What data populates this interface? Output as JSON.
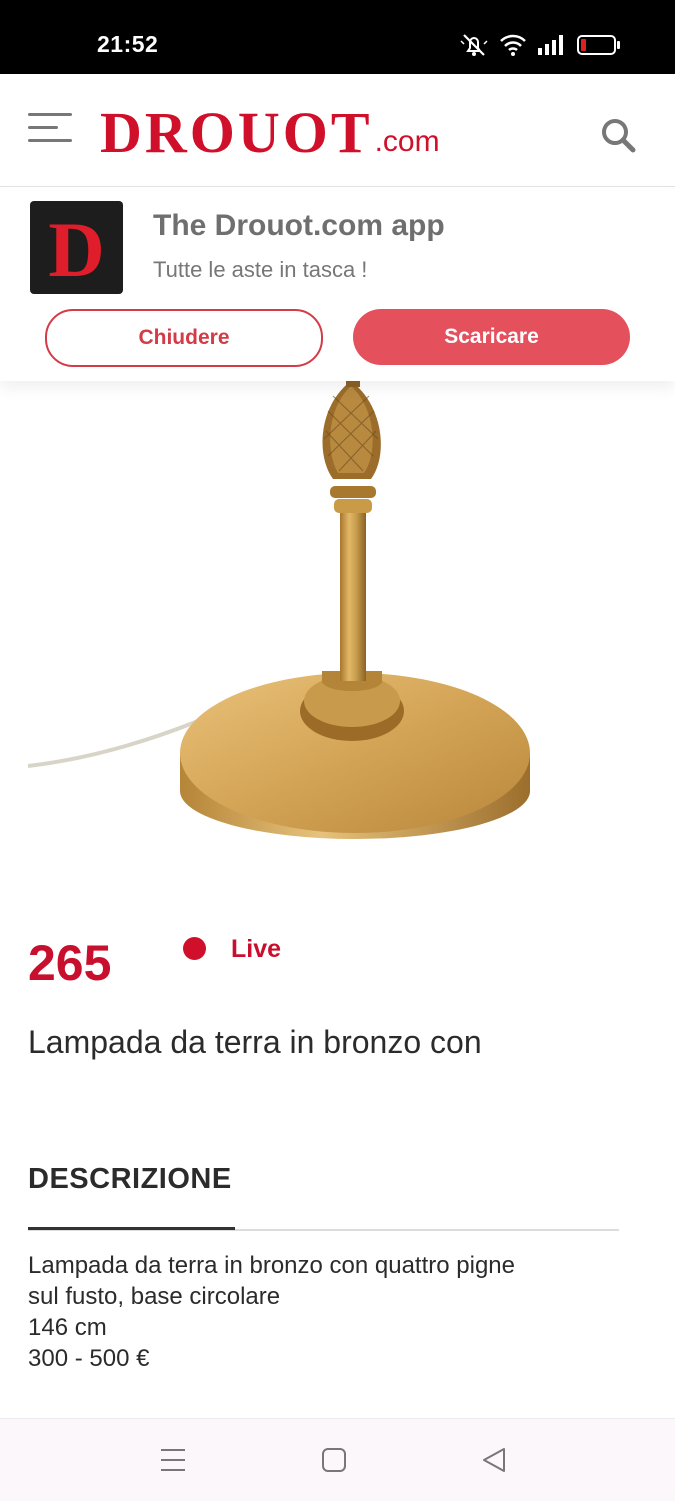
{
  "status_bar": {
    "time": "21:52",
    "icons": [
      "mute-icon",
      "wifi-icon",
      "signal-icon",
      "battery-icon"
    ]
  },
  "header": {
    "logo_main": "DROUOT",
    "logo_suffix": ".com",
    "brand_color": "#d0102a"
  },
  "app_banner": {
    "logo_letter": "D",
    "title": "The Drouot.com app",
    "subtitle": "Tutte le aste in tasca !",
    "close_label": "Chiudere",
    "download_label": "Scaricare"
  },
  "lot": {
    "number": "265",
    "status": "Live",
    "title": "Lampada da terra in bronzo con"
  },
  "description": {
    "heading": "DESCRIZIONE",
    "lines": [
      "Lampada da terra in bronzo con quattro pigne",
      "sul fusto, base circolare",
      "146 cm",
      "300 - 500 €"
    ]
  },
  "nav_bar": {
    "icons": [
      "recent-apps-icon",
      "home-icon",
      "back-icon"
    ]
  }
}
